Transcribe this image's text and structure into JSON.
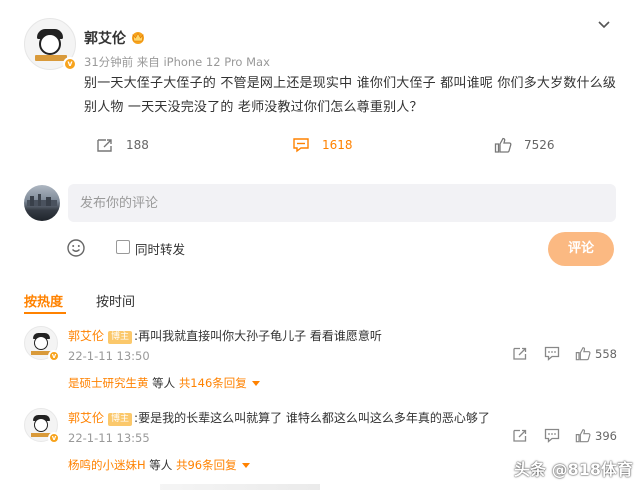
{
  "post": {
    "author": "郭艾伦",
    "meta": "31分钟前  来自 iPhone 12 Pro Max",
    "text": "别一天大侄子大侄子的 不管是网上还是现实中 谁你们大侄子 都叫谁呢 你们多大岁数什么级别人物 一天天没完没了的 老师没教过你们怎么尊重别人？",
    "repost_count": "188",
    "comment_count": "1618",
    "like_count": "7526"
  },
  "composer": {
    "placeholder": "发布你的评论",
    "repost_label": "同时转发",
    "submit_label": "评论"
  },
  "sort": {
    "hot": "按热度",
    "time": "按时间"
  },
  "comments": [
    {
      "author": "郭艾伦",
      "tag": "博主",
      "text": ":再叫我就直接叫你大孙子龟儿子 看看谁愿意听",
      "time": "22-1-11 13:50",
      "like_count": "558",
      "reply_user": "是硕士研究生黄",
      "reply_mid": " 等人 ",
      "reply_total": "共146条回复"
    },
    {
      "author": "郭艾伦",
      "tag": "博主",
      "text": ":要是我的长辈这么叫就算了 谁特么都这么叫这么多年真的恶心够了",
      "time": "22-1-11 13:55",
      "like_count": "396",
      "reply_user": "杨鸣的小迷妹H",
      "reply_mid": " 等人 ",
      "reply_total": "共96条回复"
    }
  ],
  "watermark": "头条 @818体育",
  "colors": {
    "accent": "#ff8200",
    "submit_bg": "#fbb982",
    "tag_bg": "#fbc86b"
  }
}
